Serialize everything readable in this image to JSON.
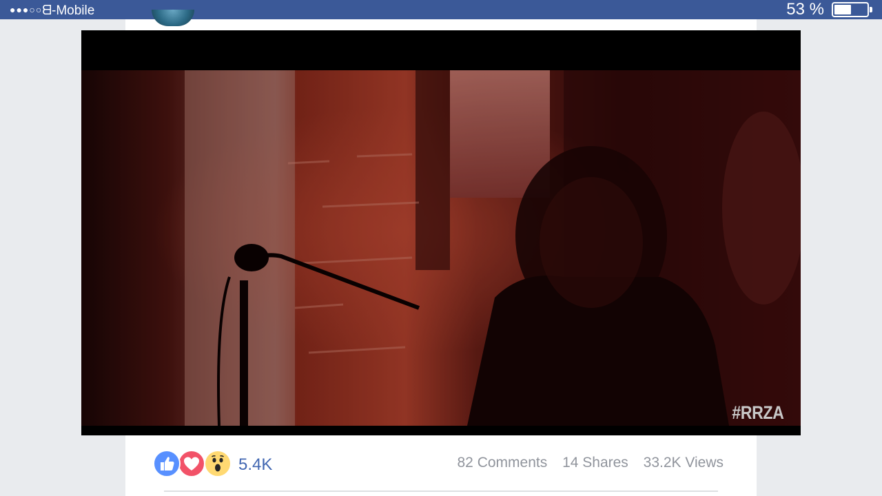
{
  "status_bar": {
    "signal_dots": "●●●○○",
    "carrier": "ᗺ-Mobile",
    "battery_percent": "53 %",
    "battery_level": 0.53
  },
  "video": {
    "hashtag": "#RRZA"
  },
  "reactions": {
    "icons": [
      "like-icon",
      "love-icon",
      "wow-icon"
    ],
    "count": "5.4K"
  },
  "stats": {
    "comments": "82 Comments",
    "shares": "14 Shares",
    "views": "33.2K Views"
  },
  "colors": {
    "status_bar": "#3b5998",
    "like": "#5890ff",
    "love": "#f25268",
    "wow": "#ffd972",
    "count_text": "#4267b2",
    "stats_text": "#90949c"
  }
}
